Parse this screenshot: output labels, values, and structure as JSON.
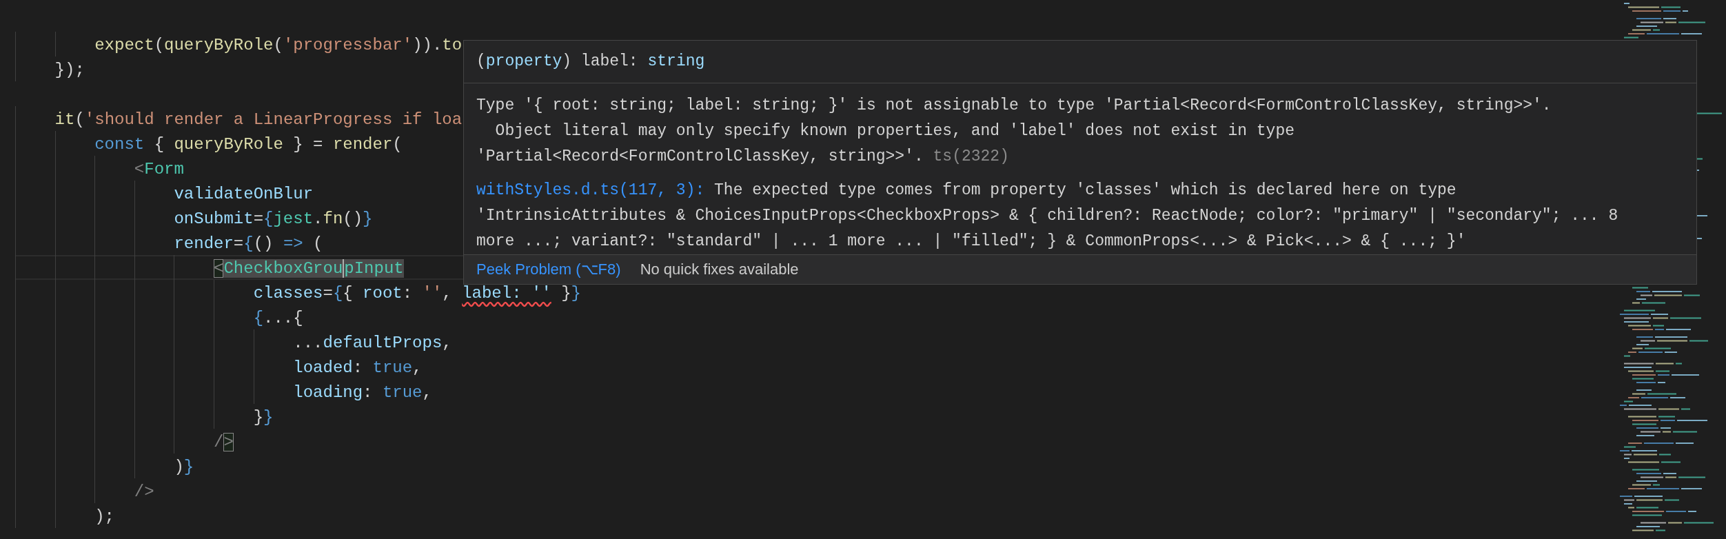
{
  "editor": {
    "lines": [
      {
        "current": false
      },
      {
        "current": false,
        "tokens": [
          {
            "text": "        expect",
            "kind": "func"
          },
          {
            "text": "(",
            "kind": "plain"
          },
          {
            "text": "queryByRole",
            "kind": "func"
          },
          {
            "text": "(",
            "kind": "plain"
          },
          {
            "text": "'progressbar'",
            "kind": "string"
          },
          {
            "text": ")).",
            "kind": "plain"
          },
          {
            "text": "to",
            "kind": "func"
          }
        ]
      },
      {
        "current": false,
        "tokens": [
          {
            "text": "    });",
            "kind": "plain"
          }
        ]
      },
      {
        "current": false
      },
      {
        "current": false,
        "tokens": [
          {
            "text": "    it",
            "kind": "func"
          },
          {
            "text": "(",
            "kind": "plain"
          },
          {
            "text": "'should render a LinearProgress if loa",
            "kind": "string"
          }
        ]
      },
      {
        "current": false,
        "tokens": [
          {
            "text": "        const",
            "kind": "keyword"
          },
          {
            "text": " { ",
            "kind": "plain"
          },
          {
            "text": "queryByRole",
            "kind": "func"
          },
          {
            "text": " } = ",
            "kind": "plain"
          },
          {
            "text": "render",
            "kind": "func"
          },
          {
            "text": "(",
            "kind": "plain"
          }
        ]
      },
      {
        "current": false,
        "tokens": [
          {
            "text": "            <",
            "kind": "angle"
          },
          {
            "text": "Form",
            "kind": "tag"
          }
        ]
      },
      {
        "current": false,
        "tokens": [
          {
            "text": "                validateOnBlur",
            "kind": "prop"
          }
        ]
      },
      {
        "current": false,
        "tokens": [
          {
            "text": "                onSubmit",
            "kind": "prop"
          },
          {
            "text": "=",
            "kind": "plain"
          },
          {
            "text": "{",
            "kind": "keyword"
          },
          {
            "text": "jest",
            "kind": "tag"
          },
          {
            "text": ".",
            "kind": "plain"
          },
          {
            "text": "fn",
            "kind": "func"
          },
          {
            "text": "()",
            "kind": "plain"
          },
          {
            "text": "}",
            "kind": "keyword"
          }
        ]
      },
      {
        "current": false,
        "tokens": [
          {
            "text": "                render",
            "kind": "prop"
          },
          {
            "text": "=",
            "kind": "plain"
          },
          {
            "text": "{",
            "kind": "keyword"
          },
          {
            "text": "() ",
            "kind": "plain"
          },
          {
            "text": "=>",
            "kind": "keyword"
          },
          {
            "text": " (",
            "kind": "plain"
          }
        ]
      },
      {
        "current": true,
        "tokens": [
          {
            "text": "                    <",
            "kind": "angle",
            "bracket_match": true
          },
          {
            "text": "CheckboxGrou",
            "kind": "tag",
            "highlighted": true
          },
          {
            "text": "pInput",
            "kind": "tag",
            "highlighted": true,
            "caret": true
          }
        ]
      },
      {
        "current": false,
        "tokens": [
          {
            "text": "                        classes",
            "kind": "prop"
          },
          {
            "text": "=",
            "kind": "plain"
          },
          {
            "text": "{",
            "kind": "keyword"
          },
          {
            "text": "{ ",
            "kind": "plain"
          },
          {
            "text": "root",
            "kind": "prop"
          },
          {
            "text": ": ",
            "kind": "plain"
          },
          {
            "text": "''",
            "kind": "string"
          },
          {
            "text": ", ",
            "kind": "plain"
          },
          {
            "text": "label: ''",
            "kind": "prop",
            "error": true
          },
          {
            "text": " }",
            "kind": "plain"
          },
          {
            "text": "}",
            "kind": "keyword"
          }
        ]
      },
      {
        "current": false,
        "tokens": [
          {
            "text": "                        {",
            "kind": "keyword"
          },
          {
            "text": "...{",
            "kind": "plain"
          }
        ]
      },
      {
        "current": false,
        "tokens": [
          {
            "text": "                            ...",
            "kind": "plain"
          },
          {
            "text": "defaultProps",
            "kind": "prop"
          },
          {
            "text": ",",
            "kind": "plain"
          }
        ]
      },
      {
        "current": false,
        "tokens": [
          {
            "text": "                            loaded",
            "kind": "prop"
          },
          {
            "text": ": ",
            "kind": "plain"
          },
          {
            "text": "true",
            "kind": "keyword"
          },
          {
            "text": ",",
            "kind": "plain"
          }
        ]
      },
      {
        "current": false,
        "tokens": [
          {
            "text": "                            loading",
            "kind": "prop"
          },
          {
            "text": ": ",
            "kind": "plain"
          },
          {
            "text": "true",
            "kind": "keyword"
          },
          {
            "text": ",",
            "kind": "plain"
          }
        ]
      },
      {
        "current": false,
        "tokens": [
          {
            "text": "                        }",
            "kind": "plain"
          },
          {
            "text": "}",
            "kind": "keyword"
          }
        ]
      },
      {
        "current": false,
        "tokens": [
          {
            "text": "                    /",
            "kind": "angle"
          },
          {
            "text": ">",
            "kind": "angle",
            "bracket_match": true
          }
        ]
      },
      {
        "current": false,
        "tokens": [
          {
            "text": "                )",
            "kind": "plain"
          },
          {
            "text": "}",
            "kind": "keyword"
          }
        ]
      },
      {
        "current": false,
        "tokens": [
          {
            "text": "            />",
            "kind": "angle"
          }
        ]
      },
      {
        "current": false,
        "tokens": [
          {
            "text": "        );",
            "kind": "plain"
          }
        ]
      }
    ]
  },
  "hover": {
    "signature": [
      {
        "text": "(",
        "kind": "plain"
      },
      {
        "text": "property",
        "kind": "type"
      },
      {
        "text": ") label: ",
        "kind": "plain"
      },
      {
        "text": "string",
        "kind": "type"
      }
    ],
    "message": {
      "lines": [
        "Type '{ root: string; label: string; }' is not assignable to type 'Partial<Record<FormControlClassKey, string>>'.",
        "  Object literal may only specify known properties, and 'label' does not exist in type",
        "'Partial<Record<FormControlClassKey, string>>'."
      ],
      "code": "ts(2322)"
    },
    "related": {
      "link": "withStyles.d.ts(117, 3):",
      "lines": [
        " The expected type comes from property 'classes' which is declared here on type",
        "'IntrinsicAttributes & ChoicesInputProps<CheckboxProps> & { children?: ReactNode; color?: \"primary\" | \"secondary\"; ... 8",
        "more ...; variant?: \"standard\" | ... 1 more ... | \"filled\"; } & CommonProps<...> & Pick<...> & { ...; }'"
      ]
    },
    "actions": {
      "peek": "Peek Problem (⌥F8)",
      "quick_fixes": "No quick fixes available"
    }
  }
}
